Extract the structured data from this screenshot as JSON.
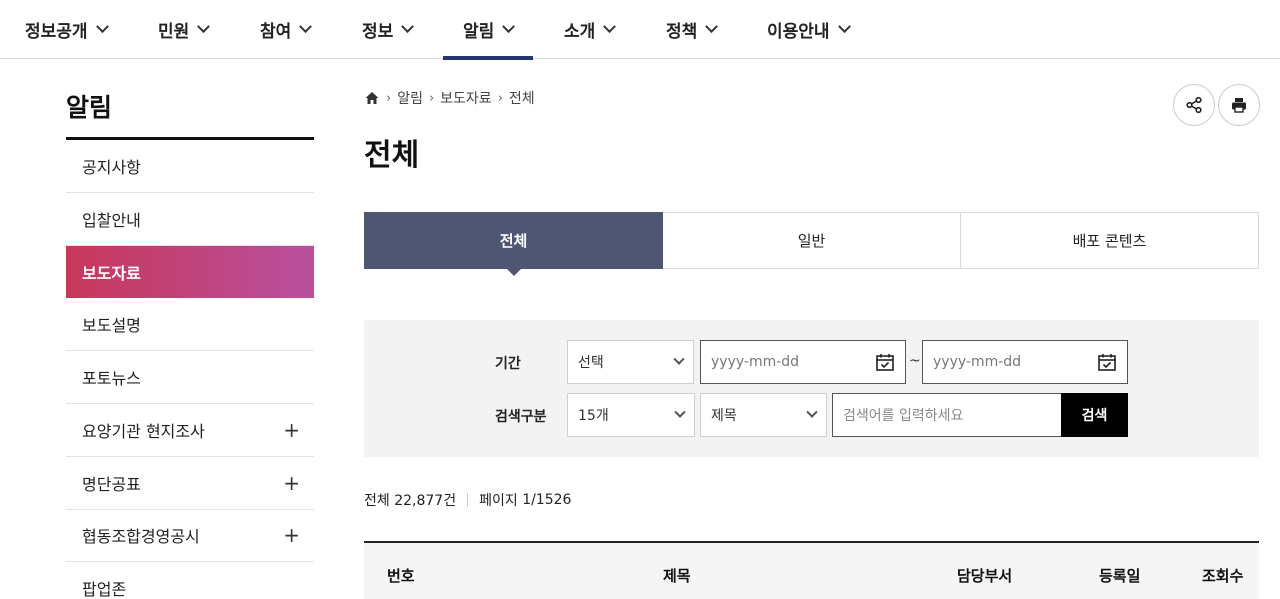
{
  "topnav": [
    {
      "label": "정보공개"
    },
    {
      "label": "민원"
    },
    {
      "label": "참여"
    },
    {
      "label": "정보"
    },
    {
      "label": "알림",
      "active": true
    },
    {
      "label": "소개"
    },
    {
      "label": "정책"
    },
    {
      "label": "이용안내"
    }
  ],
  "sidebar": {
    "title": "알림",
    "items": [
      {
        "label": "공지사항"
      },
      {
        "label": "입찰안내"
      },
      {
        "label": "보도자료",
        "active": true
      },
      {
        "label": "보도설명"
      },
      {
        "label": "포토뉴스"
      },
      {
        "label": "요양기관 현지조사",
        "expand": "+"
      },
      {
        "label": "명단공표",
        "expand": "+"
      },
      {
        "label": "협동조합경영공시",
        "expand": "+"
      },
      {
        "label": "팝업존"
      }
    ]
  },
  "breadcrumb": {
    "home_icon": "home-icon",
    "items": [
      "알림",
      "보도자료",
      "전체"
    ]
  },
  "page_title": "전체",
  "actions": {
    "share_icon": "share-icon",
    "print_icon": "print-icon"
  },
  "tabs": [
    {
      "label": "전체",
      "active": true
    },
    {
      "label": "일반"
    },
    {
      "label": "배포 콘텐츠"
    }
  ],
  "search": {
    "period_label": "기간",
    "period_select": "선택",
    "date_start_placeholder": "yyyy-mm-dd",
    "date_end_placeholder": "yyyy-mm-dd",
    "date_separator": "~",
    "type_label": "검색구분",
    "page_size": "15개",
    "field": "제목",
    "keyword_placeholder": "검색어를 입력하세요",
    "button": "검색"
  },
  "counts": {
    "total_label": "전체",
    "total": "22,877건",
    "page_label": "페이지",
    "page": "1/1526"
  },
  "table": {
    "headers": [
      "번호",
      "제목",
      "담당부서",
      "등록일",
      "조회수"
    ]
  },
  "colors": {
    "active_tab": "#4f5673",
    "sidebar_active_start": "#c8375a",
    "sidebar_active_end": "#b8509e",
    "nav_underline": "#23366d"
  }
}
